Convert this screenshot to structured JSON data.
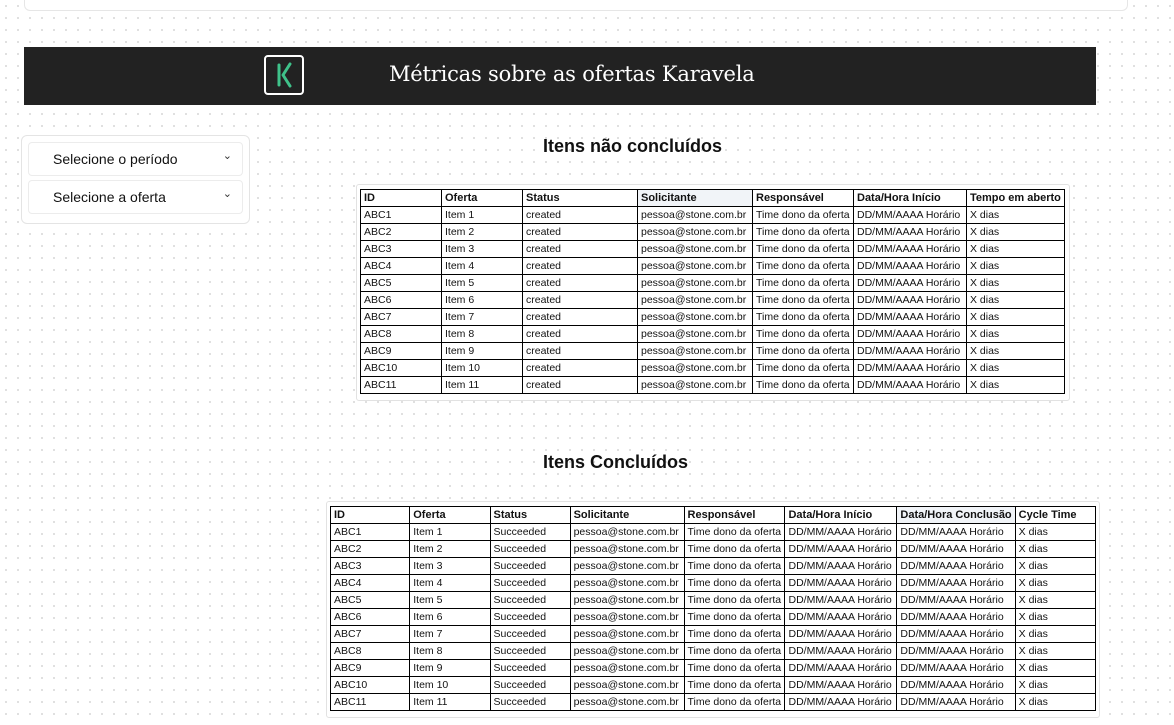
{
  "header": {
    "title": "Métricas sobre as ofertas Karavela",
    "logo_icon": "karavela-logo-icon",
    "background_color": "#222222"
  },
  "filters": {
    "period_label": "Selecione o período",
    "offer_label": "Selecione a oferta"
  },
  "open_items": {
    "title": "Itens não concluídos",
    "columns": [
      "ID",
      "Oferta",
      "Status",
      "Solicitante",
      "Responsável",
      "Data/Hora Início",
      "Tempo em aberto"
    ],
    "rows": [
      [
        "ABC1",
        "Item 1",
        "created",
        "pessoa@stone.com.br",
        "Time dono da oferta",
        "DD/MM/AAAA Horário",
        "X dias"
      ],
      [
        "ABC2",
        "Item 2",
        "created",
        "pessoa@stone.com.br",
        "Time dono da oferta",
        "DD/MM/AAAA Horário",
        "X dias"
      ],
      [
        "ABC3",
        "Item 3",
        "created",
        "pessoa@stone.com.br",
        "Time dono da oferta",
        "DD/MM/AAAA Horário",
        "X dias"
      ],
      [
        "ABC4",
        "Item 4",
        "created",
        "pessoa@stone.com.br",
        "Time dono da oferta",
        "DD/MM/AAAA Horário",
        "X dias"
      ],
      [
        "ABC5",
        "Item 5",
        "created",
        "pessoa@stone.com.br",
        "Time dono da oferta",
        "DD/MM/AAAA Horário",
        "X dias"
      ],
      [
        "ABC6",
        "Item 6",
        "created",
        "pessoa@stone.com.br",
        "Time dono da oferta",
        "DD/MM/AAAA Horário",
        "X dias"
      ],
      [
        "ABC7",
        "Item 7",
        "created",
        "pessoa@stone.com.br",
        "Time dono da oferta",
        "DD/MM/AAAA Horário",
        "X dias"
      ],
      [
        "ABC8",
        "Item 8",
        "created",
        "pessoa@stone.com.br",
        "Time dono da oferta",
        "DD/MM/AAAA Horário",
        "X dias"
      ],
      [
        "ABC9",
        "Item 9",
        "created",
        "pessoa@stone.com.br",
        "Time dono da oferta",
        "DD/MM/AAAA Horário",
        "X dias"
      ],
      [
        "ABC10",
        "Item 10",
        "created",
        "pessoa@stone.com.br",
        "Time dono da oferta",
        "DD/MM/AAAA Horário",
        "X dias"
      ],
      [
        "ABC11",
        "Item 11",
        "created",
        "pessoa@stone.com.br",
        "Time dono da oferta",
        "DD/MM/AAAA Horário",
        "X dias"
      ]
    ]
  },
  "done_items": {
    "title": "Itens Concluídos",
    "columns": [
      "ID",
      "Oferta",
      "Status",
      "Solicitante",
      "Responsável",
      "Data/Hora Início",
      "Data/Hora Conclusão",
      "Cycle Time"
    ],
    "rows": [
      [
        "ABC1",
        "Item 1",
        "Succeeded",
        "pessoa@stone.com.br",
        "Time dono da oferta",
        "DD/MM/AAAA Horário",
        "DD/MM/AAAA Horário",
        "X dias"
      ],
      [
        "ABC2",
        "Item 2",
        "Succeeded",
        "pessoa@stone.com.br",
        "Time dono da oferta",
        "DD/MM/AAAA Horário",
        "DD/MM/AAAA Horário",
        "X dias"
      ],
      [
        "ABC3",
        "Item 3",
        "Succeeded",
        "pessoa@stone.com.br",
        "Time dono da oferta",
        "DD/MM/AAAA Horário",
        "DD/MM/AAAA Horário",
        "X dias"
      ],
      [
        "ABC4",
        "Item 4",
        "Succeeded",
        "pessoa@stone.com.br",
        "Time dono da oferta",
        "DD/MM/AAAA Horário",
        "DD/MM/AAAA Horário",
        "X dias"
      ],
      [
        "ABC5",
        "Item 5",
        "Succeeded",
        "pessoa@stone.com.br",
        "Time dono da oferta",
        "DD/MM/AAAA Horário",
        "DD/MM/AAAA Horário",
        "X dias"
      ],
      [
        "ABC6",
        "Item 6",
        "Succeeded",
        "pessoa@stone.com.br",
        "Time dono da oferta",
        "DD/MM/AAAA Horário",
        "DD/MM/AAAA Horário",
        "X dias"
      ],
      [
        "ABC7",
        "Item 7",
        "Succeeded",
        "pessoa@stone.com.br",
        "Time dono da oferta",
        "DD/MM/AAAA Horário",
        "DD/MM/AAAA Horário",
        "X dias"
      ],
      [
        "ABC8",
        "Item 8",
        "Succeeded",
        "pessoa@stone.com.br",
        "Time dono da oferta",
        "DD/MM/AAAA Horário",
        "DD/MM/AAAA Horário",
        "X dias"
      ],
      [
        "ABC9",
        "Item 9",
        "Succeeded",
        "pessoa@stone.com.br",
        "Time dono da oferta",
        "DD/MM/AAAA Horário",
        "DD/MM/AAAA Horário",
        "X dias"
      ],
      [
        "ABC10",
        "Item 10",
        "Succeeded",
        "pessoa@stone.com.br",
        "Time dono da oferta",
        "DD/MM/AAAA Horário",
        "DD/MM/AAAA Horário",
        "X dias"
      ],
      [
        "ABC11",
        "Item 11",
        "Succeeded",
        "pessoa@stone.com.br",
        "Time dono da oferta",
        "DD/MM/AAAA Horário",
        "DD/MM/AAAA Horário",
        "X dias"
      ]
    ]
  }
}
